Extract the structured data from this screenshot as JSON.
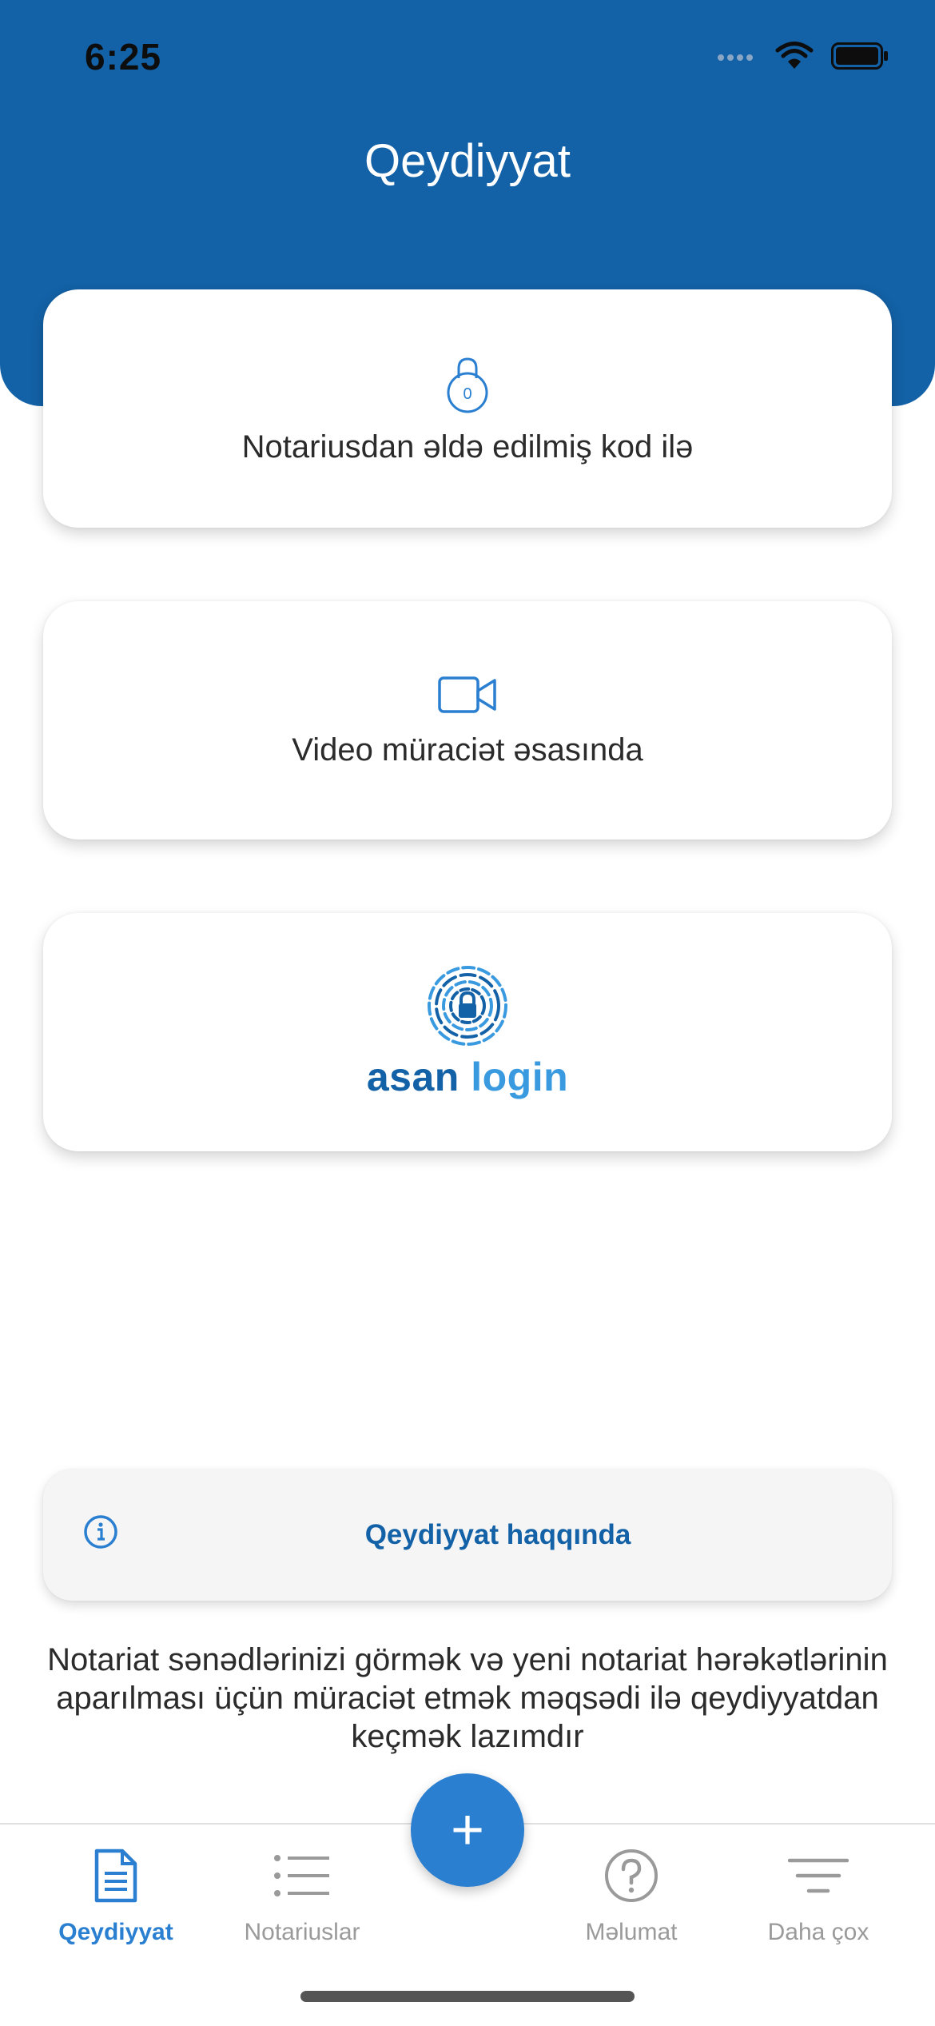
{
  "status_bar": {
    "time": "6:25"
  },
  "header": {
    "title": "Qeydiyyat"
  },
  "options": [
    {
      "label": "Notariusdan əldə edilmiş kod ilə",
      "icon": "lock-icon"
    },
    {
      "label": "Video müraciət əsasında",
      "icon": "video-camera-icon"
    },
    {
      "label_part1": "asan",
      "label_part2": "login",
      "icon": "fingerprint-lock-icon"
    }
  ],
  "info_bar": {
    "label": "Qeydiyyat haqqında",
    "icon": "info-icon"
  },
  "description": "Notariat sənədlərinizi görmək və yeni notariat hərəkətlərinin aparılması üçün müraciət etmək məqsədi ilə qeydiyyatdan keçmək lazımdır",
  "fab": {
    "label": "+"
  },
  "tabs": [
    {
      "label": "Qeydiyyat",
      "icon": "document-icon",
      "active": true
    },
    {
      "label": "Notariuslar",
      "icon": "list-icon",
      "active": false
    },
    {
      "label": "Məlumat",
      "icon": "question-icon",
      "active": false
    },
    {
      "label": "Daha çox",
      "icon": "menu-lines-icon",
      "active": false
    }
  ],
  "colors": {
    "primary": "#1361a6",
    "accent": "#2a7fd1",
    "inactive": "#9a9a9a"
  }
}
